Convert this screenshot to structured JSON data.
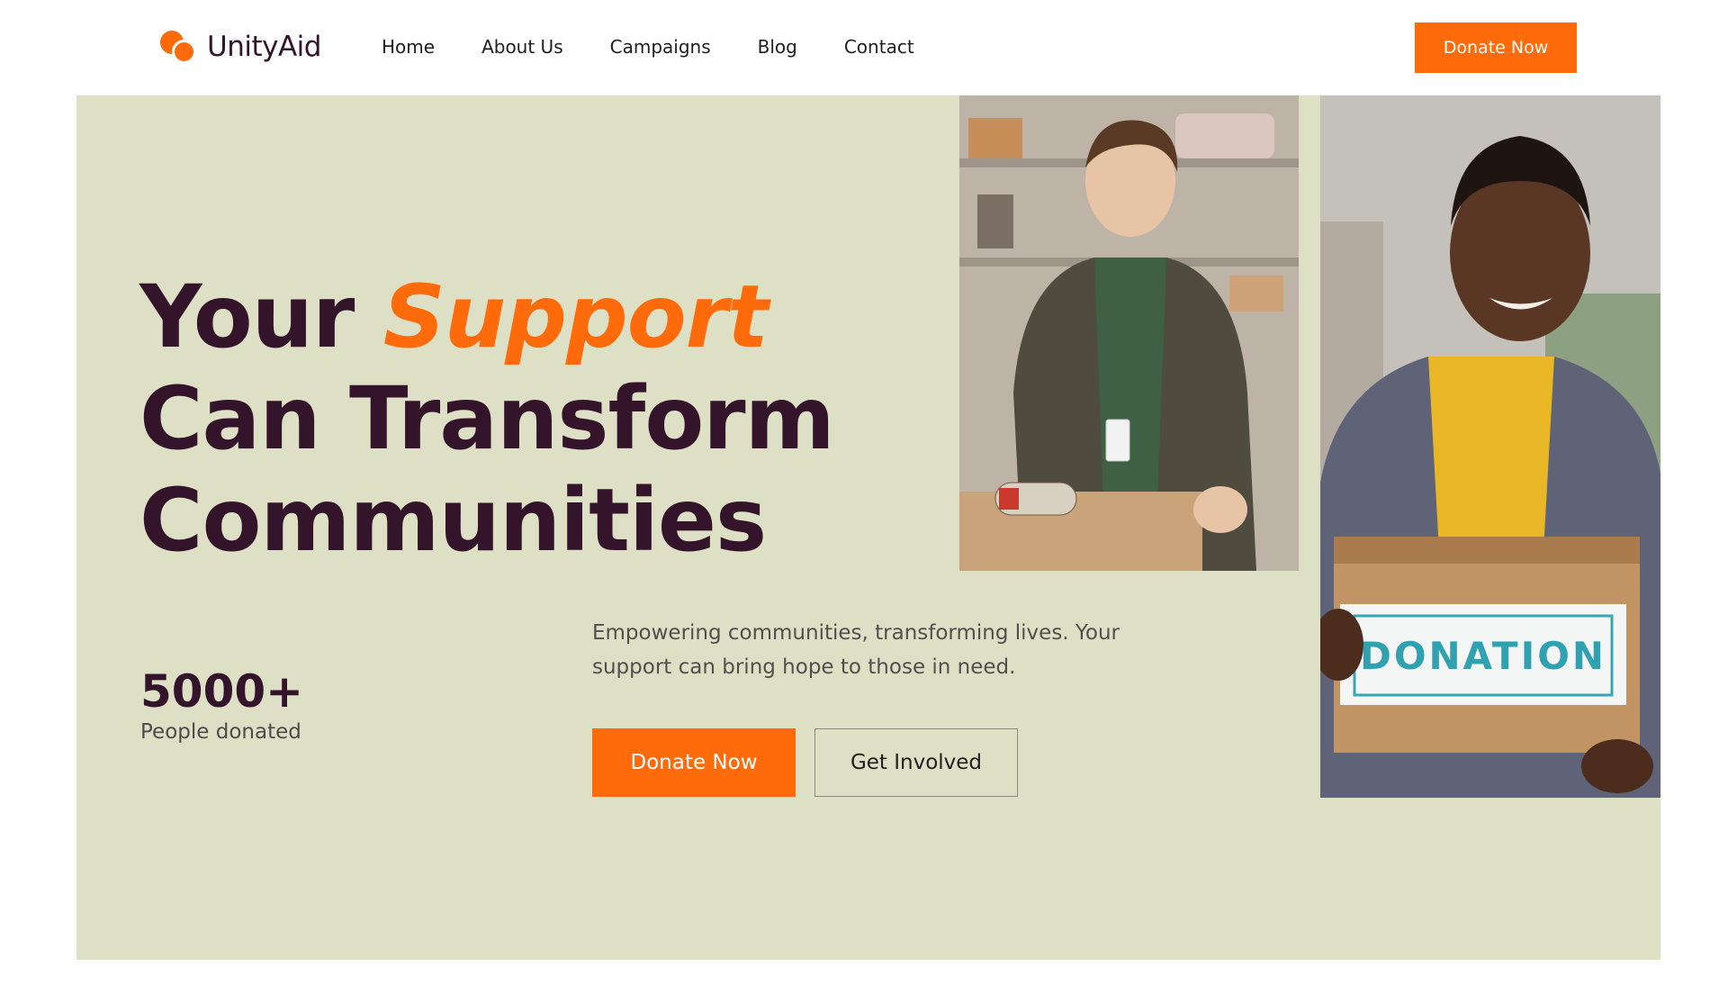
{
  "brand": {
    "name": "UnityAid",
    "accent": "#ff6b0a",
    "dark": "#34142b",
    "hero_bg": "#dee0c6"
  },
  "nav": {
    "items": [
      {
        "label": "Home"
      },
      {
        "label": "About Us"
      },
      {
        "label": "Campaigns"
      },
      {
        "label": "Blog"
      },
      {
        "label": "Contact"
      }
    ]
  },
  "header": {
    "cta_label": "Donate Now"
  },
  "hero": {
    "headline_word1": "Your",
    "headline_accent": "Support",
    "headline_line2": "Can Transform",
    "headline_line3": "Communities",
    "stat_value": "5000+",
    "stat_label": "People donated",
    "description": "Empowering communities, transforming lives. Your support can bring hope to those in need.",
    "primary_cta": "Donate Now",
    "secondary_cta": "Get Involved",
    "box_label": "DONATION"
  }
}
